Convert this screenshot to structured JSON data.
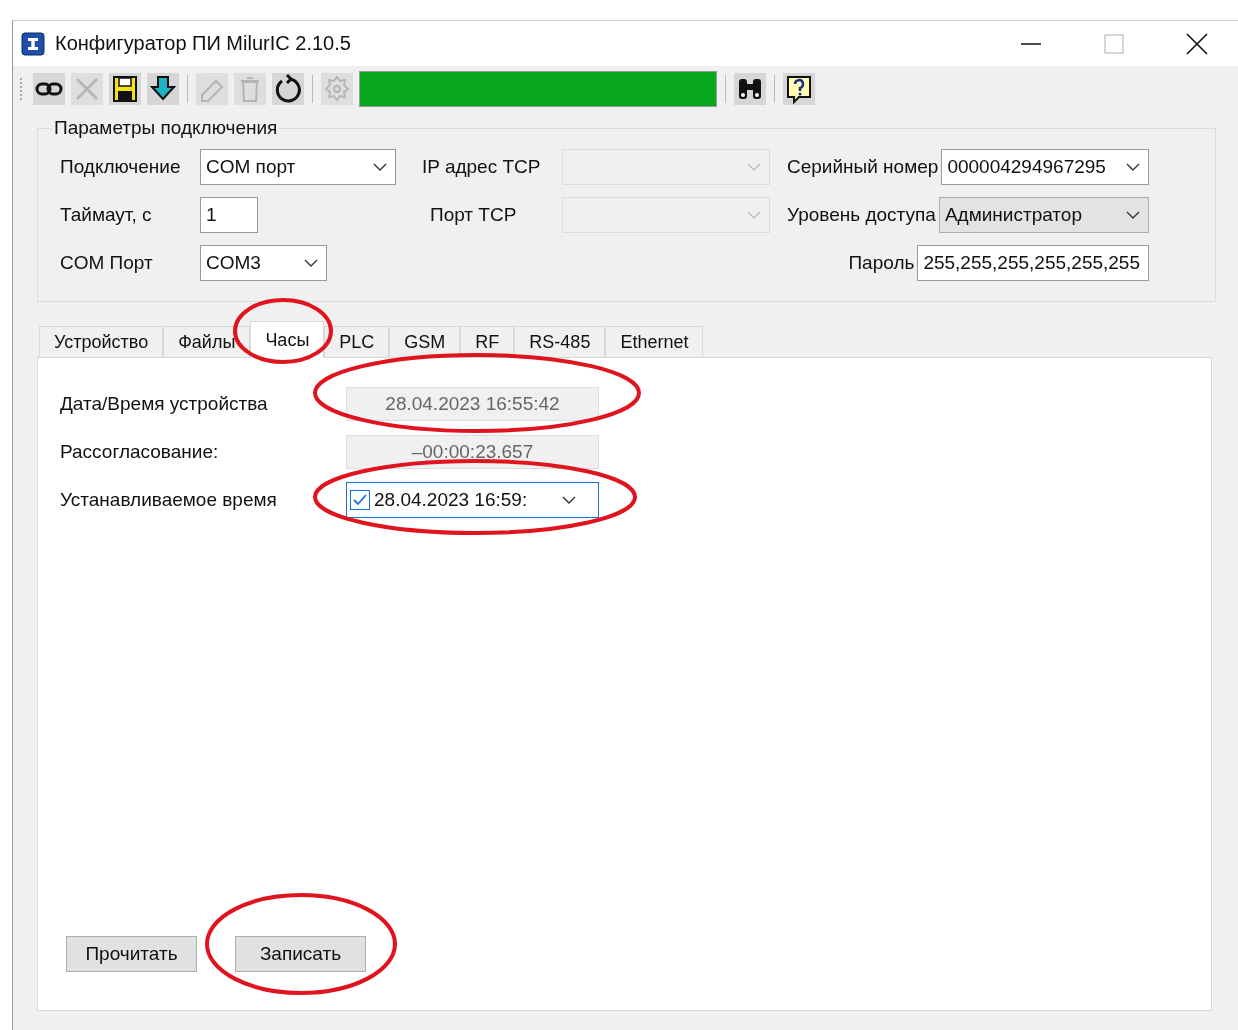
{
  "window": {
    "title": "Конфигуратор ПИ MilurIC 2.10.5"
  },
  "toolbar": {
    "buttons": [
      {
        "kind": "link",
        "disabled": false
      },
      {
        "kind": "cross",
        "disabled": true
      },
      {
        "kind": "save",
        "disabled": false
      },
      {
        "kind": "download",
        "disabled": false
      },
      {
        "kind": "separator"
      },
      {
        "kind": "eraser",
        "disabled": true
      },
      {
        "kind": "trash",
        "disabled": true
      },
      {
        "kind": "refresh",
        "disabled": false
      },
      {
        "kind": "separator"
      },
      {
        "kind": "gear",
        "disabled": true
      },
      {
        "kind": "progress"
      },
      {
        "kind": "separator"
      },
      {
        "kind": "binoculars",
        "disabled": false
      },
      {
        "kind": "separator"
      },
      {
        "kind": "help",
        "disabled": false
      }
    ]
  },
  "connection": {
    "title": "Параметры подключения",
    "left": [
      {
        "label": "Подключение",
        "value": "COM порт",
        "kind": "combo",
        "disabled": false
      },
      {
        "label": "Таймаут, с",
        "value": "1",
        "kind": "text",
        "disabled": false
      },
      {
        "label": "COM Порт",
        "value": "COM3",
        "kind": "combo",
        "disabled": false
      }
    ],
    "middle": [
      {
        "label": "IP адрес TCP",
        "kind": "combo",
        "disabled": true
      },
      {
        "label": "Порт TCP",
        "kind": "combo",
        "disabled": true
      }
    ],
    "right": [
      {
        "label": "Серийный номер",
        "value": "000004294967295",
        "kind": "combo",
        "disabled": false
      },
      {
        "label": "Уровень доступа",
        "value": "Администратор",
        "kind": "combo",
        "disabled": true
      },
      {
        "label": "Пароль",
        "value": "255,255,255,255,255,255",
        "kind": "text",
        "disabled": false
      }
    ]
  },
  "tabs": [
    {
      "label": "Устройство",
      "selected": false
    },
    {
      "label": "Файлы",
      "selected": false
    },
    {
      "label": "Часы",
      "selected": true
    },
    {
      "label": "PLC",
      "selected": false
    },
    {
      "label": "GSM",
      "selected": false
    },
    {
      "label": "RF",
      "selected": false
    },
    {
      "label": "RS-485",
      "selected": false
    },
    {
      "label": "Ethernet",
      "selected": false
    }
  ],
  "clock": {
    "rows": [
      {
        "label": "Дата/Время устройства",
        "value": "28.04.2023 16:55:42",
        "kind": "readonly"
      },
      {
        "label": "Рассогласование:",
        "value": "–00:00:23.657",
        "kind": "readonly"
      },
      {
        "label": "Устанавливаемое время",
        "value": "28.04.2023 16:59:",
        "kind": "datetime",
        "checked": true
      }
    ],
    "buttons": [
      "Прочитать",
      "Записать"
    ]
  }
}
